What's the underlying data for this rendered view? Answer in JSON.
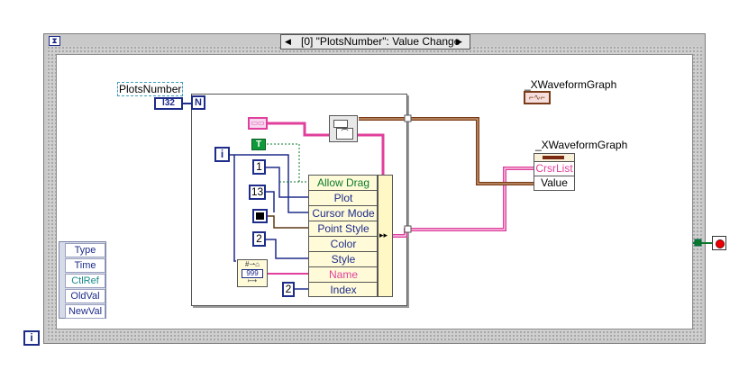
{
  "event_structure": {
    "case_label": "[0] \"PlotsNumber\": Value Change",
    "prev_arrow": "◀",
    "next_arrow": "▶",
    "hourglass": "⧗",
    "iteration": "i",
    "event_data": [
      "Type",
      "Time",
      "CtlRef",
      "OldVal",
      "NewVal"
    ]
  },
  "terminal": {
    "label": "PlotsNumber",
    "type": "I32"
  },
  "for_loop": {
    "count_label": "N",
    "index_label": "i",
    "constants": [
      "1",
      "13",
      "2",
      "2"
    ],
    "bool_const": "T",
    "number_to_string": "999",
    "properties": [
      "Allow Drag",
      "Plot",
      "Cursor Mode",
      "Point Style",
      "Color",
      "Style",
      "Name",
      "Index"
    ]
  },
  "graph_ref": {
    "label": "_XWaveformGraph"
  },
  "property_node2": {
    "label": "_XWaveformGraph",
    "props": [
      "CrsrList",
      "Value"
    ]
  },
  "colors": {
    "wire_blue": "#1e2c8a",
    "wire_pink": "#e0409c",
    "wire_brown": "#7a3b18",
    "wire_green": "#0a7a2a"
  }
}
